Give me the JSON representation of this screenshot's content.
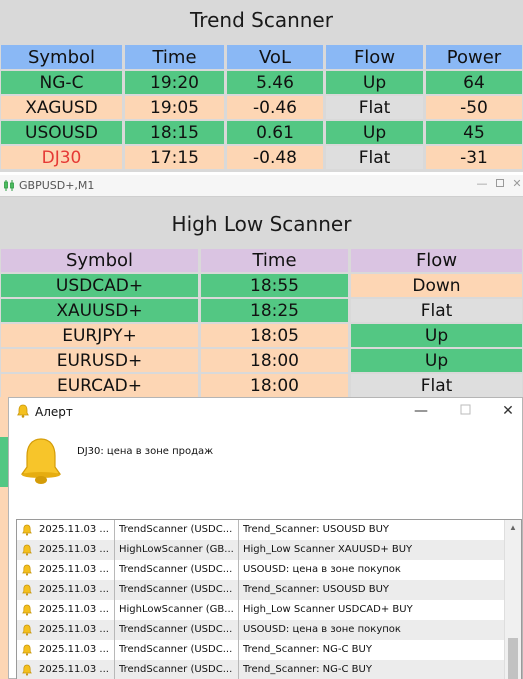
{
  "trend_scanner": {
    "title": "Trend Scanner",
    "headers": [
      "Symbol",
      "Time",
      "VoL",
      "Flow",
      "Power"
    ],
    "rows": [
      {
        "symbol": "NG-C",
        "time": "19:20",
        "vol": "5.46",
        "flow": "Up",
        "power": "64"
      },
      {
        "symbol": "XAGUSD",
        "time": "19:05",
        "vol": "-0.46",
        "flow": "Flat",
        "power": "-50"
      },
      {
        "symbol": "USOUSD",
        "time": "18:15",
        "vol": "0.61",
        "flow": "Up",
        "power": "45"
      },
      {
        "symbol": "DJ30",
        "time": "17:15",
        "vol": "-0.48",
        "flow": "Flat",
        "power": "-31"
      }
    ]
  },
  "chart_window": {
    "title": "GBPUSD+,M1"
  },
  "high_low_scanner": {
    "title": "High Low Scanner",
    "headers": [
      "Symbol",
      "Time",
      "Flow"
    ],
    "rows": [
      {
        "symbol": "USDCAD+",
        "time": "18:55",
        "flow": "Down"
      },
      {
        "symbol": "XAUUSD+",
        "time": "18:25",
        "flow": "Flat"
      },
      {
        "symbol": "EURJPY+",
        "time": "18:05",
        "flow": "Up"
      },
      {
        "symbol": "EURUSD+",
        "time": "18:00",
        "flow": "Up"
      },
      {
        "symbol": "EURCAD+",
        "time": "18:00",
        "flow": "Flat"
      }
    ]
  },
  "alert_dialog": {
    "title": "Алерт",
    "message": "DJ30: цена в зоне продаж",
    "entries": [
      {
        "time": "2025.11.03 ...",
        "source": "TrendScanner (USDC...",
        "text": "Trend_Scanner: USOUSD BUY"
      },
      {
        "time": "2025.11.03 ...",
        "source": "HighLowScanner (GB...",
        "text": "High_Low Scanner XAUUSD+ BUY"
      },
      {
        "time": "2025.11.03 ...",
        "source": "TrendScanner (USDC...",
        "text": "USOUSD: цена в зоне покупок"
      },
      {
        "time": "2025.11.03 ...",
        "source": "TrendScanner (USDC...",
        "text": "Trend_Scanner: USOUSD BUY"
      },
      {
        "time": "2025.11.03 ...",
        "source": "HighLowScanner (GB...",
        "text": "High_Low Scanner USDCAD+ BUY"
      },
      {
        "time": "2025.11.03 ...",
        "source": "TrendScanner (USDC...",
        "text": "USOUSD: цена в зоне покупок"
      },
      {
        "time": "2025.11.03 ...",
        "source": "TrendScanner (USDC...",
        "text": "Trend_Scanner: NG-C BUY"
      },
      {
        "time": "2025.11.03 ...",
        "source": "TrendScanner (USDC...",
        "text": "Trend_Scanner: NG-C BUY"
      }
    ]
  },
  "colors": {
    "up": "#53c783",
    "flat": "#dedede",
    "sell_row": "#fdd6b4",
    "header_trend": "#8ab8f5",
    "header_highlow": "#dac4e2",
    "dj30_text": "#e53935"
  }
}
